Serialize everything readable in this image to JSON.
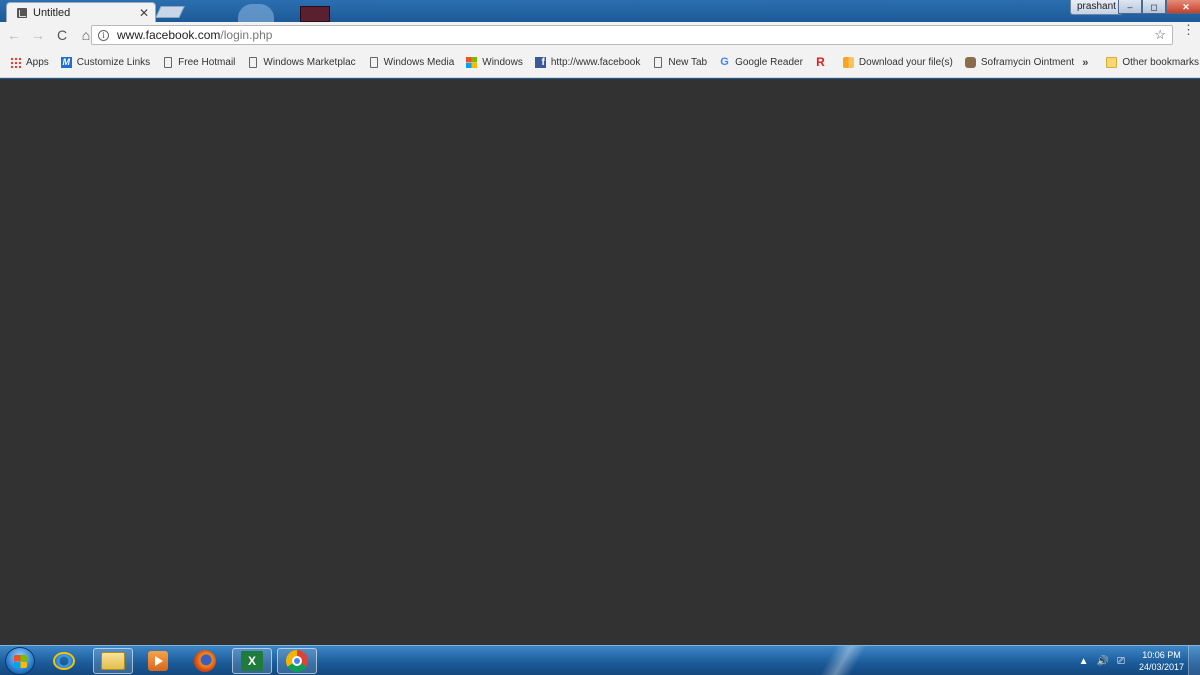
{
  "window": {
    "user_name": "prashant",
    "controls": {
      "minimize": "–",
      "maximize": "◻",
      "close": "✕"
    }
  },
  "tabs": [
    {
      "title": "Untitled",
      "active": true,
      "icon": "page-favicon-icon"
    }
  ],
  "toolbar": {
    "back": "←",
    "forward": "→",
    "reload": "C",
    "home": "⌂",
    "url_host": "www.facebook.com",
    "url_path": "/login.php",
    "star": "☆",
    "menu": "⋮"
  },
  "bookmarks": {
    "items": [
      {
        "label": "Apps",
        "icon": "apps-grid-icon"
      },
      {
        "label": "Customize Links",
        "icon": "m-logo-icon"
      },
      {
        "label": "Free Hotmail",
        "icon": "page-icon"
      },
      {
        "label": "Windows Marketplac",
        "icon": "page-icon"
      },
      {
        "label": "Windows Media",
        "icon": "page-icon"
      },
      {
        "label": "Windows",
        "icon": "windows-logo-icon"
      },
      {
        "label": "http://www.facebook",
        "icon": "facebook-icon"
      },
      {
        "label": "New Tab",
        "icon": "page-icon"
      },
      {
        "label": "Google Reader",
        "icon": "google-icon"
      },
      {
        "label": "",
        "icon": "red-r-icon"
      },
      {
        "label": "Download your file(s)",
        "icon": "download-icon"
      },
      {
        "label": "Soframycin Ointment",
        "icon": "medicine-icon"
      }
    ],
    "overflow": "»",
    "other": "Other bookmarks"
  },
  "taskbar": {
    "apps": [
      {
        "name": "internet-explorer",
        "icon": "ie-icon"
      },
      {
        "name": "windows-explorer",
        "icon": "folder-icon"
      },
      {
        "name": "media-player",
        "icon": "media-play-icon"
      },
      {
        "name": "firefox",
        "icon": "firefox-icon"
      },
      {
        "name": "excel",
        "icon": "excel-icon"
      },
      {
        "name": "chrome",
        "icon": "chrome-icon"
      }
    ],
    "tray": {
      "up_arrow": "▲",
      "volume": "🔊",
      "network": "⎚"
    },
    "clock": {
      "time": "10:06 PM",
      "date": "24/03/2017"
    }
  },
  "colors": {
    "content_bg": "#323232",
    "chrome_bg": "#f2f2f2",
    "taskbar": "#1b5a98"
  }
}
